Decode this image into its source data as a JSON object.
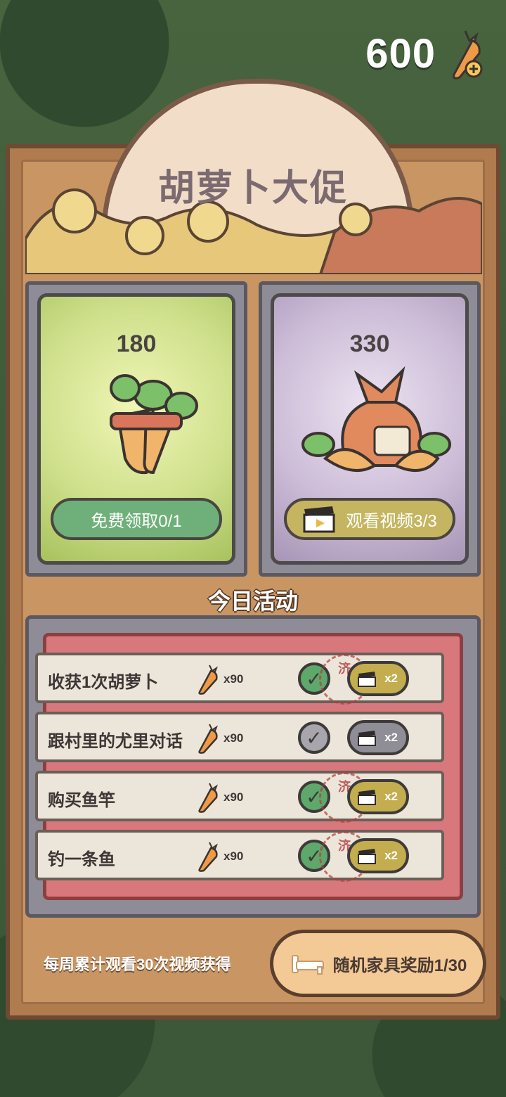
{
  "currency": {
    "amount": "600",
    "icon": "carrot-plus-icon"
  },
  "title": "胡萝卜大促",
  "offers": [
    {
      "amount": "180",
      "button": "免费领取0/1",
      "theme": "green"
    },
    {
      "amount": "330",
      "button": "观看视频3/3",
      "theme": "purple"
    }
  ],
  "activities": {
    "title": "今日活动",
    "items": [
      {
        "label": "收获1次胡萝卜",
        "reward": "x90",
        "multiplier": "x2",
        "done": true,
        "stamp": "济"
      },
      {
        "label": "跟村里的尤里对话",
        "reward": "x90",
        "multiplier": "x2",
        "done": false,
        "stamp": ""
      },
      {
        "label": "购买鱼竿",
        "reward": "x90",
        "multiplier": "x2",
        "done": true,
        "stamp": "济"
      },
      {
        "label": "钓一条鱼",
        "reward": "x90",
        "multiplier": "x2",
        "done": true,
        "stamp": "济"
      }
    ]
  },
  "weekly": {
    "text": "每周累计观看30次视频获得",
    "button": "随机家具奖励1/30"
  },
  "colors": {
    "panel": "#c99563",
    "green_btn": "#6fb07a",
    "olive_btn": "#c5b560",
    "activity_bg": "#d8787c"
  }
}
